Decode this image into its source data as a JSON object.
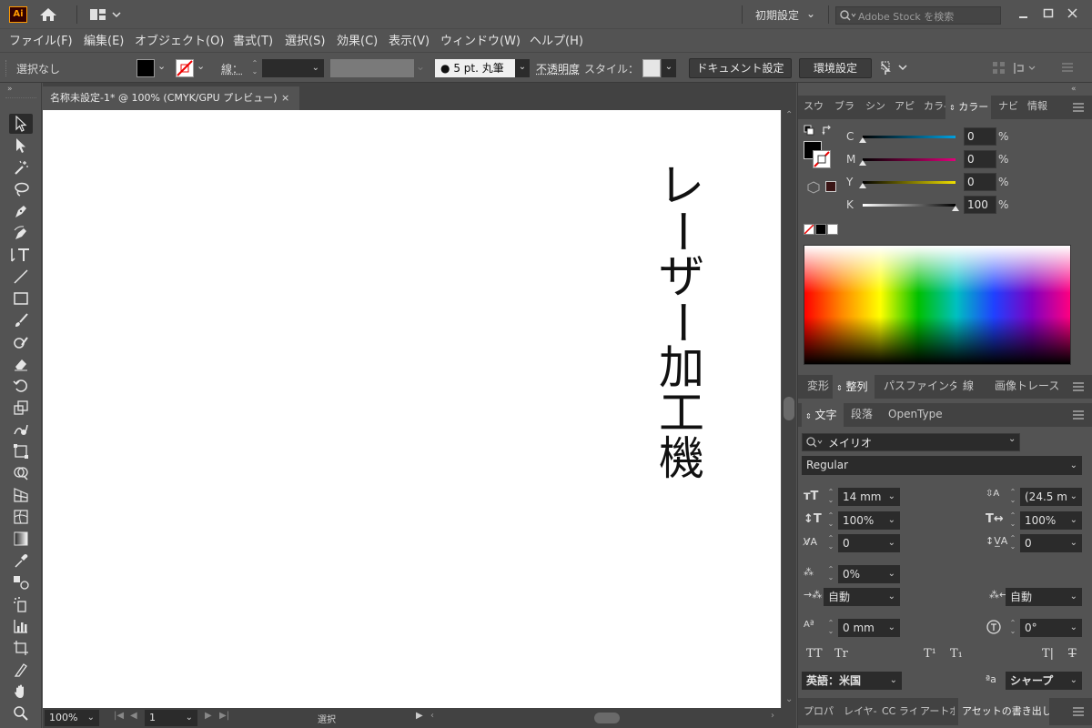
{
  "app": {
    "logo": "Ai",
    "workspace": "初期設定",
    "search_placeholder": "Adobe Stock を検索"
  },
  "menu": [
    "ファイル(F)",
    "編集(E)",
    "オブジェクト(O)",
    "書式(T)",
    "選択(S)",
    "効果(C)",
    "表示(V)",
    "ウィンドウ(W)",
    "ヘルプ(H)"
  ],
  "control": {
    "selection": "選択なし",
    "stroke_label": "線：",
    "brush": "5 pt. 丸筆",
    "opacity": "不透明度",
    "style": "スタイル：",
    "doc_setup": "ドキュメント設定",
    "prefs": "環境設定"
  },
  "document": {
    "tab_title": "名称未設定-1* @ 100% (CMYK/GPU プレビュー)",
    "close": "×",
    "canvas_text": [
      "レ",
      "ー",
      "ザ",
      "ー",
      "加",
      "工",
      "機"
    ]
  },
  "status": {
    "zoom": "100%",
    "page": "1",
    "tool": "選択"
  },
  "color_panel": {
    "tabs": [
      "スウ",
      "ブラ",
      "シン",
      "アピ",
      "カラ-",
      "カラー",
      "ナビ",
      "情報"
    ],
    "channels": [
      {
        "name": "C",
        "value": "0",
        "unit": "%"
      },
      {
        "name": "M",
        "value": "0",
        "unit": "%"
      },
      {
        "name": "Y",
        "value": "0",
        "unit": "%"
      },
      {
        "name": "K",
        "value": "100",
        "unit": "%"
      }
    ]
  },
  "align_panel": {
    "tabs": [
      "変形",
      "整列",
      "パスファインダー",
      "線",
      "画像トレース"
    ]
  },
  "char_panel": {
    "tabs": [
      "文字",
      "段落",
      "OpenType"
    ],
    "font": "メイリオ",
    "style": "Regular",
    "size": "14 mm",
    "leading": "(24.5 m",
    "vscale": "100%",
    "hscale": "100%",
    "kerning": "0",
    "tracking": "0",
    "tsume": "0%",
    "aki_left": "自動",
    "aki_right": "自動",
    "baseline": "0 mm",
    "rotation": "0°",
    "tt": [
      "TT",
      "Tr",
      "T¹",
      "T₁",
      "T|",
      "T"
    ],
    "language": "英語：米国",
    "antialias": "シャープ",
    "aa": "ªa"
  },
  "bottom_tabs": [
    "プロパ",
    "レイヤ-",
    "CC ライ",
    "アートボ",
    "アセットの書き出し"
  ],
  "colors": {
    "bg": "#535353",
    "panel": "#535353",
    "dark": "#2b2b2b",
    "canvas": "#ffffff",
    "accent": "#ff9a00"
  }
}
